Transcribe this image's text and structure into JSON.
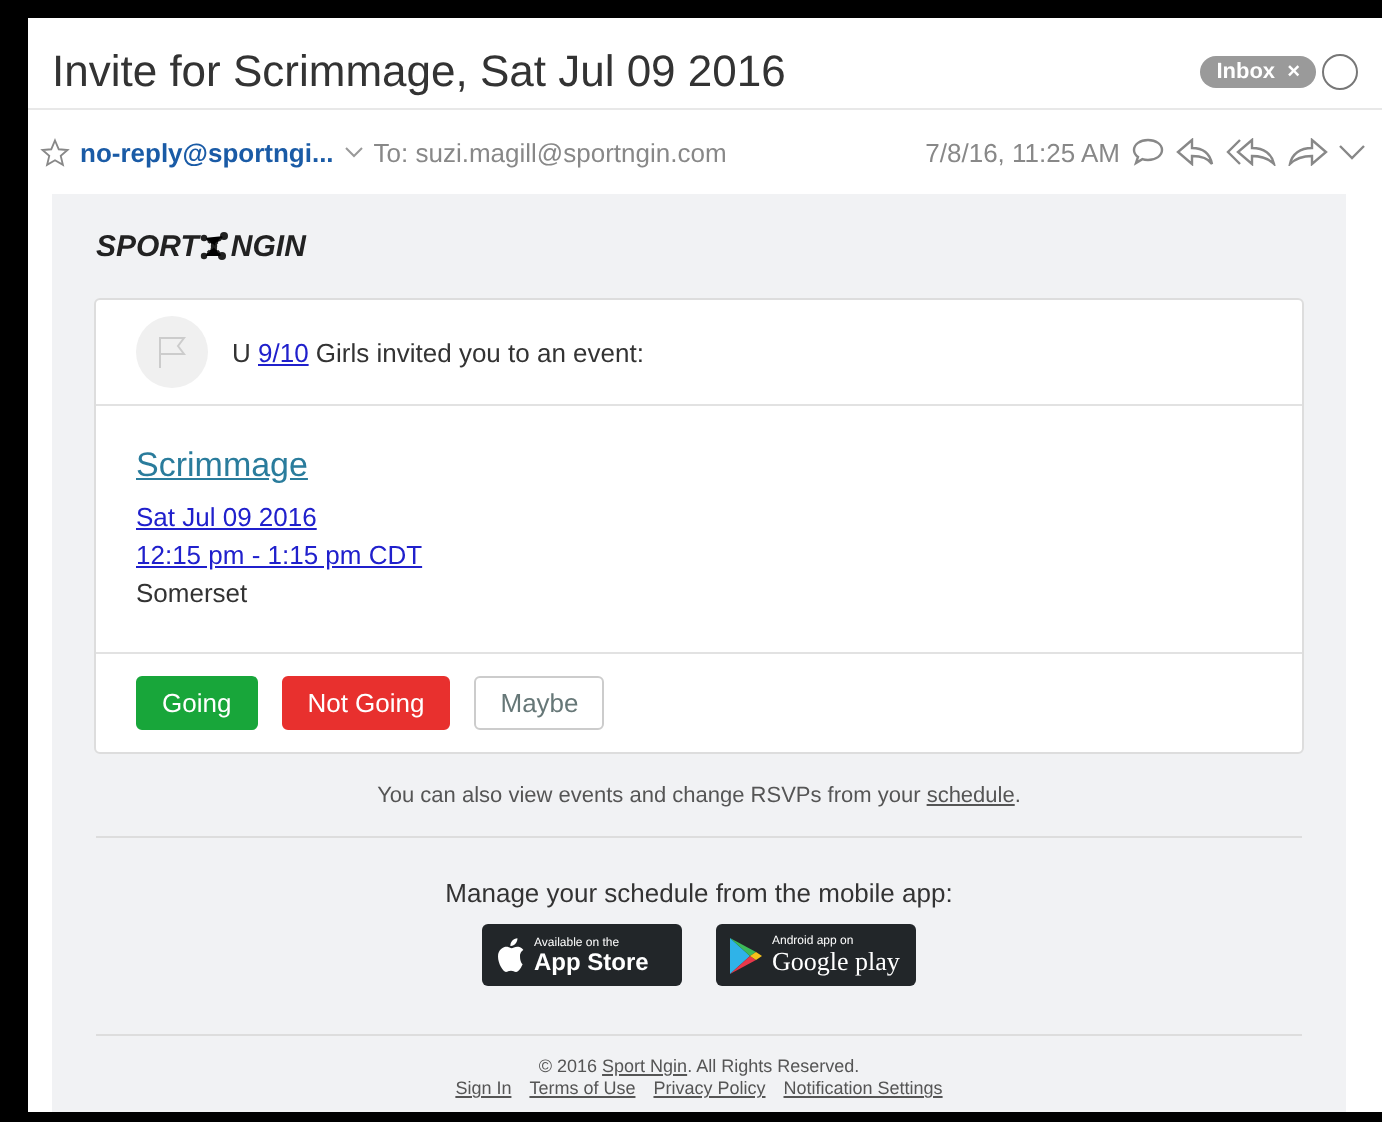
{
  "message": {
    "subject": "Invite for Scrimmage, Sat Jul 09 2016",
    "mailbox_tag": "Inbox",
    "tag_close": "×",
    "from": "no-reply@sportngi...",
    "to": "To: suzi.magill@sportngin.com",
    "date": "7/8/16, 11:25 AM"
  },
  "email": {
    "logo": {
      "left": "SPORT",
      "right": "NGIN"
    },
    "invite": {
      "before": "U ",
      "link": "9/10",
      "after": " Girls invited you to an event:"
    },
    "event": {
      "title": "Scrimmage",
      "date": "Sat Jul 09 2016",
      "time": "12:15 pm - 1:15 pm CDT",
      "location": "Somerset"
    },
    "rsvp_buttons": [
      {
        "label": "Going",
        "kind": "going"
      },
      {
        "label": "Not Going",
        "kind": "declined"
      },
      {
        "label": "Maybe",
        "kind": "maybe"
      }
    ],
    "note": {
      "before": "You can also view events and change RSVPs from your ",
      "link": "schedule",
      "after": "."
    },
    "app_heading": "Manage your schedule from the mobile app:",
    "app_badges": [
      {
        "kind": "apple",
        "small": "Available on the",
        "big": "App Store"
      },
      {
        "kind": "google",
        "small": "Android app on",
        "big": "Google play"
      }
    ],
    "footer": {
      "before": "© 2016 ",
      "link": "Sport Ngin",
      "after": ". All Rights Reserved.",
      "links": [
        "Sign In",
        "Terms of Use",
        "Privacy Policy",
        "Notification Settings"
      ]
    }
  }
}
